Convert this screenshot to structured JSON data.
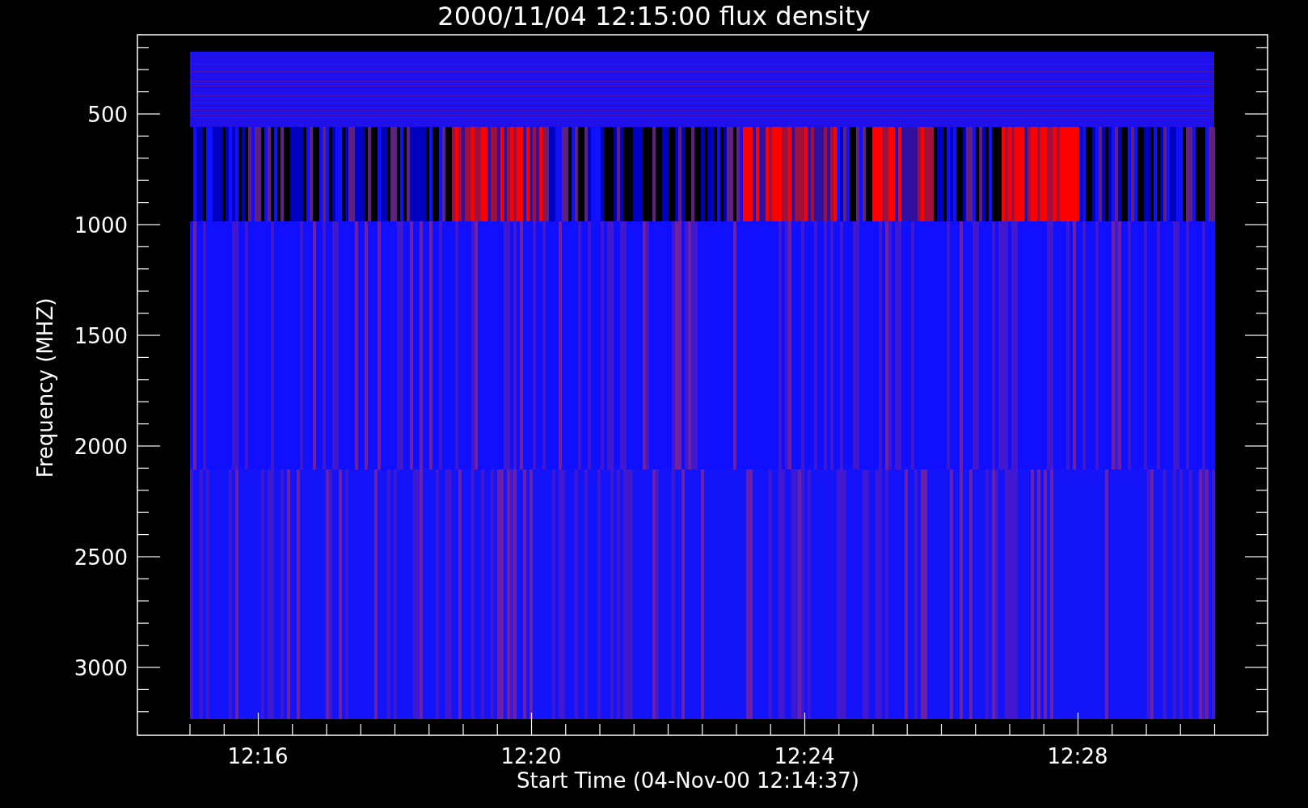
{
  "title": "2000/11/04 12:15:00 flux density",
  "y_axis": {
    "label": "Frequency (MHZ)",
    "ticks": [
      "500",
      "1000",
      "1500",
      "2000",
      "2500",
      "3000"
    ]
  },
  "x_axis": {
    "label": "Start Time (04-Nov-00 12:14:37)",
    "ticks": [
      "12:16",
      "12:20",
      "12:24",
      "12:28"
    ]
  }
}
